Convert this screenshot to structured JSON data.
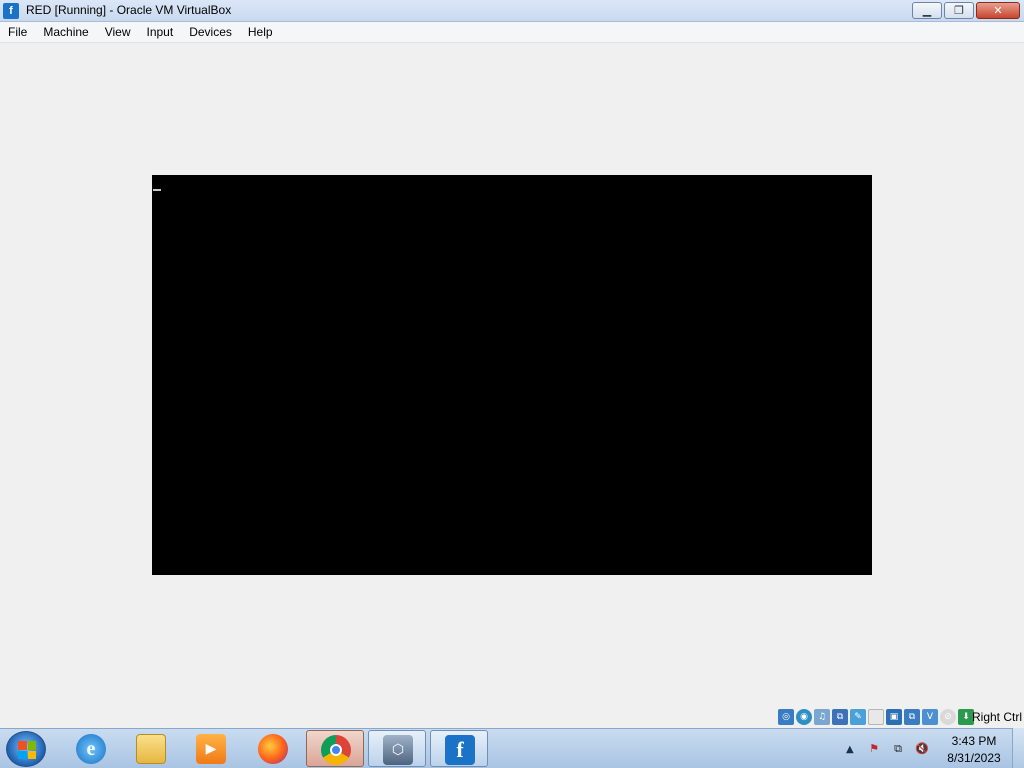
{
  "window": {
    "title": "RED [Running] - Oracle VM VirtualBox",
    "app_icon": "virtualbox-icon"
  },
  "menu": {
    "items": [
      "File",
      "Machine",
      "View",
      "Input",
      "Devices",
      "Help"
    ]
  },
  "statusbar": {
    "icons": [
      "hard-disk-icon",
      "optical-drive-icon",
      "audio-icon",
      "network-icon",
      "usb-icon",
      "shared-folders-icon",
      "display-icon",
      "recording-icon",
      "cpu-icon",
      "capture-icon",
      "mouse-integration-icon",
      "keyboard-icon"
    ],
    "host_key": "Right Ctrl"
  },
  "taskbar": {
    "apps": [
      "internet-explorer-icon",
      "file-explorer-icon",
      "media-player-icon",
      "firefox-icon",
      "chrome-icon",
      "virtualbox-icon",
      "virtualbox-vm-icon"
    ],
    "active_app": "chrome-icon"
  },
  "tray": {
    "icons": [
      "flag-error-icon",
      "network-icon",
      "volume-muted-icon"
    ],
    "time": "3:43 PM",
    "date": "8/31/2023"
  }
}
